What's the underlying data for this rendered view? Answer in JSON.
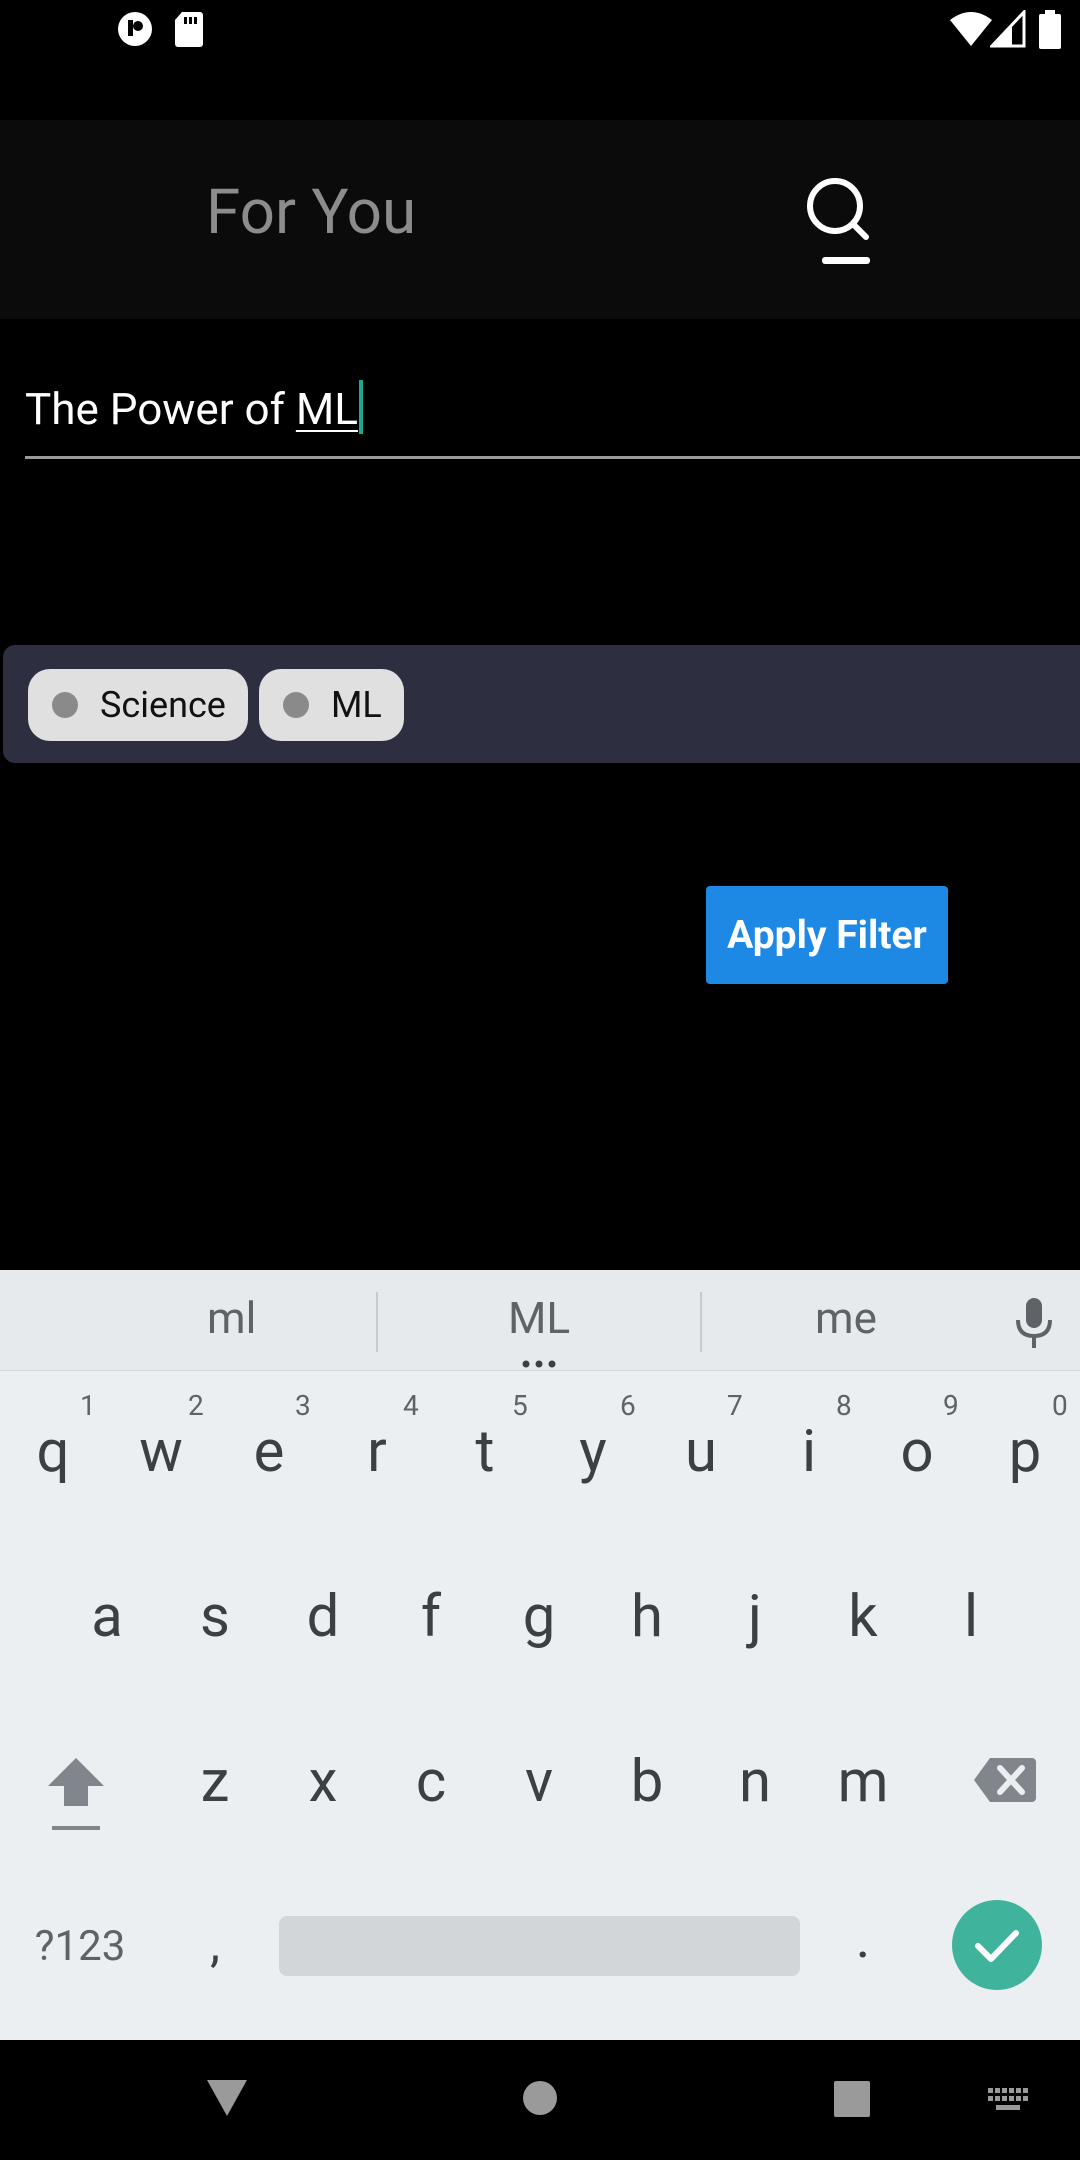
{
  "status_bar": {
    "icons": [
      "notification-icon",
      "sd-card-icon",
      "wifi-icon",
      "signal-icon",
      "battery-icon"
    ]
  },
  "app_bar": {
    "tab_for_you": "For You",
    "search_icon": "search-icon"
  },
  "search": {
    "text_prefix": "The Power of ",
    "text_composing": "ML"
  },
  "chips": [
    {
      "label": "Science"
    },
    {
      "label": "ML"
    }
  ],
  "apply_filter_label": "Apply Filter",
  "keyboard": {
    "suggestions": [
      "ml",
      "ML",
      "me"
    ],
    "row1": [
      "q",
      "w",
      "e",
      "r",
      "t",
      "y",
      "u",
      "i",
      "o",
      "p"
    ],
    "row1_numbers": [
      "1",
      "2",
      "3",
      "4",
      "5",
      "6",
      "7",
      "8",
      "9",
      "0"
    ],
    "row2": [
      "a",
      "s",
      "d",
      "f",
      "g",
      "h",
      "j",
      "k",
      "l"
    ],
    "row3": [
      "z",
      "x",
      "c",
      "v",
      "b",
      "n",
      "m"
    ],
    "symbols_key": "?123",
    "comma_key": ",",
    "period_key": "."
  },
  "colors": {
    "accent": "#1e88e5",
    "chip_strip": "#2d2f40",
    "enter_key": "#3fb39b"
  }
}
